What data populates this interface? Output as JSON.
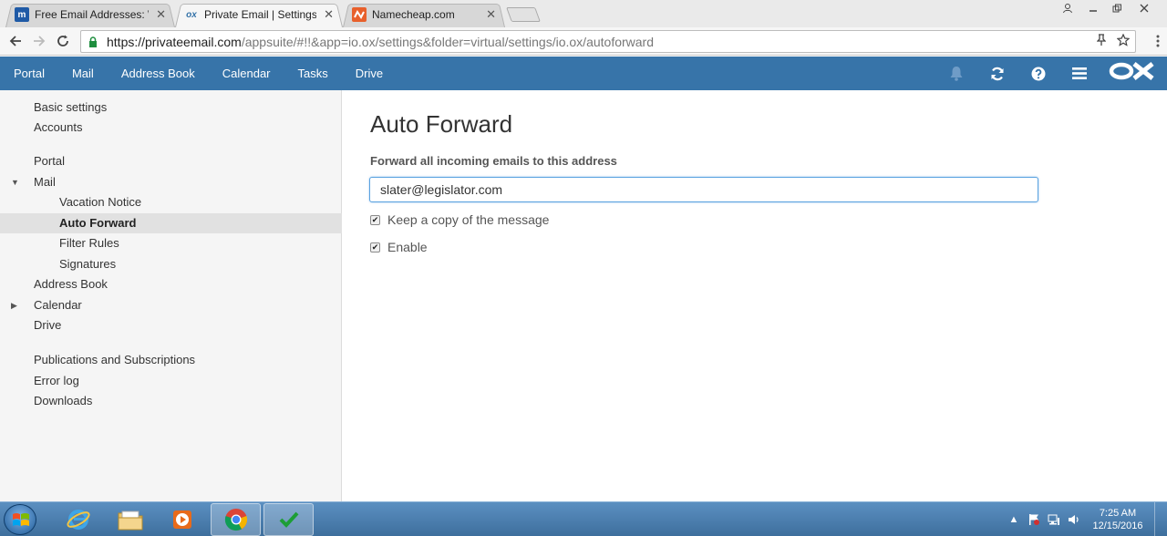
{
  "browser": {
    "tabs": [
      {
        "title": "Free Email Addresses: W",
        "favicon": "m-favicon"
      },
      {
        "title": "Private Email | Settings A",
        "favicon": "ox-favicon"
      },
      {
        "title": "Namecheap.com",
        "favicon": "namecheap-favicon"
      }
    ],
    "url_host": "https://privateemail.com",
    "url_path": "/appsuite/#!!&app=io.ox/settings&folder=virtual/settings/io.ox/autoforward"
  },
  "topbar": {
    "nav": [
      "Portal",
      "Mail",
      "Address Book",
      "Calendar",
      "Tasks",
      "Drive"
    ],
    "logo": "OX",
    "color": "#3774a9"
  },
  "sidebar": {
    "items": [
      {
        "label": "Basic settings"
      },
      {
        "label": "Accounts"
      },
      {
        "label": "Portal"
      },
      {
        "label": "Mail"
      },
      {
        "label": "Vacation Notice"
      },
      {
        "label": "Auto Forward"
      },
      {
        "label": "Filter Rules"
      },
      {
        "label": "Signatures"
      },
      {
        "label": "Address Book"
      },
      {
        "label": "Calendar"
      },
      {
        "label": "Drive"
      },
      {
        "label": "Publications and Subscriptions"
      },
      {
        "label": "Error log"
      },
      {
        "label": "Downloads"
      }
    ],
    "selected": "Auto Forward"
  },
  "main": {
    "title": "Auto Forward",
    "field_label": "Forward all incoming emails to this address",
    "forward_address": "slater@legislator.com",
    "keep_copy_label": "Keep a copy of the message",
    "keep_copy_checked": true,
    "enable_label": "Enable",
    "enable_checked": true
  },
  "taskbar": {
    "time": "7:25 AM",
    "date": "12/15/2016"
  }
}
